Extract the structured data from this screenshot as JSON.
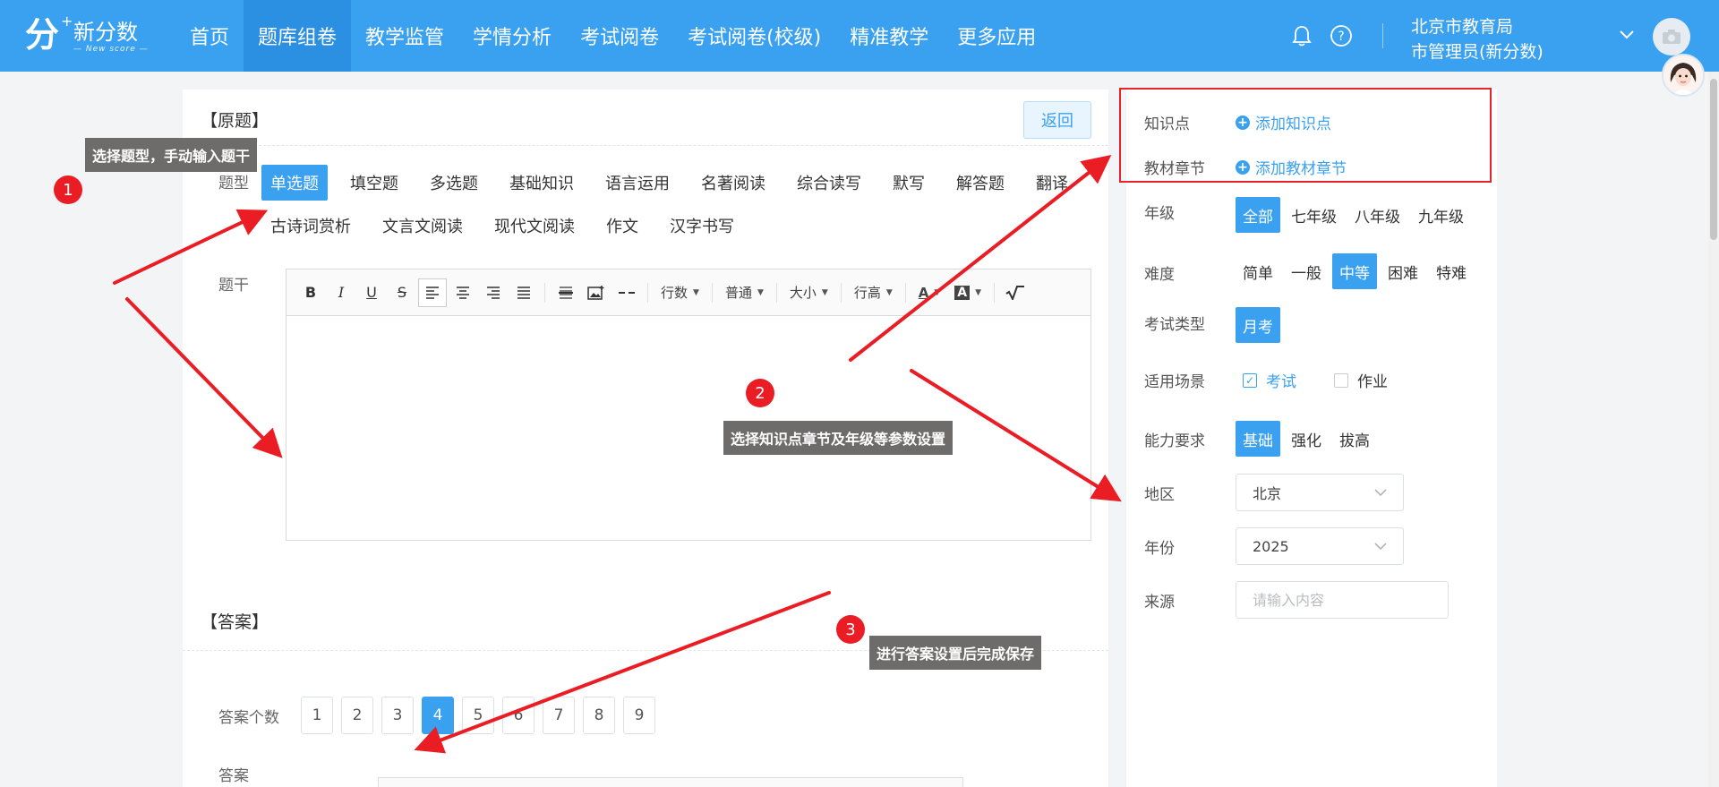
{
  "logo": {
    "name": "新分数",
    "tagline": "— New score —"
  },
  "nav": {
    "items": [
      "首页",
      "题库组卷",
      "教学监管",
      "学情分析",
      "考试阅卷",
      "考试阅卷(校级)",
      "精准教学",
      "更多应用"
    ],
    "active": "题库组卷"
  },
  "user": {
    "org": "北京市教育局",
    "role": "市管理员(新分数)"
  },
  "icons": {
    "bell": "bell-icon",
    "help": "help-icon",
    "caret": "chevron-down-icon",
    "camera": "camera-icon"
  },
  "original": {
    "title": "【原题】",
    "back_label": "返回",
    "type_label": "题型",
    "types_row1": [
      "单选题",
      "填空题",
      "多选题",
      "基础知识",
      "语言运用",
      "名著阅读",
      "综合读写",
      "默写",
      "解答题",
      "翻译"
    ],
    "types_row2": [
      "古诗词赏析",
      "文言文阅读",
      "现代文阅读",
      "作文",
      "汉字书写"
    ],
    "active_type": "单选题",
    "stem_label": "题干",
    "toolbar": {
      "bold": "B",
      "italic": "I",
      "underline": "U",
      "strike": "S",
      "dropdowns": [
        "行数",
        "普通",
        "大小",
        "行高"
      ],
      "font_color": "A",
      "bg_color": "A"
    }
  },
  "answer": {
    "title": "【答案】",
    "count_label": "答案个数",
    "counts": [
      "1",
      "2",
      "3",
      "4",
      "5",
      "6",
      "7",
      "8",
      "9"
    ],
    "active_count": "4",
    "answer_label": "答案"
  },
  "settings": {
    "knowledge_label": "知识点",
    "add_knowledge": "添加知识点",
    "chapter_label": "教材章节",
    "add_chapter": "添加教材章节",
    "grade_label": "年级",
    "grades": [
      "全部",
      "七年级",
      "八年级",
      "九年级"
    ],
    "active_grade": "全部",
    "difficulty_label": "难度",
    "difficulties": [
      "简单",
      "一般",
      "中等",
      "困难",
      "特难"
    ],
    "active_difficulty": "中等",
    "exam_type_label": "考试类型",
    "exam_type": "月考",
    "scene_label": "适用场景",
    "scene_exam": "考试",
    "scene_exam_checked": true,
    "scene_homework": "作业",
    "scene_homework_checked": false,
    "ability_label": "能力要求",
    "abilities": [
      "基础",
      "强化",
      "拔高"
    ],
    "active_ability": "基础",
    "region_label": "地区",
    "region": "北京",
    "year_label": "年份",
    "year": "2025",
    "source_label": "来源",
    "source_placeholder": "请输入内容"
  },
  "annotations": {
    "step1": "1",
    "tip1": "选择题型，手动输入题干",
    "step2": "2",
    "tip2": "选择知识点章节及年级等参数设置",
    "step3": "3",
    "tip3": "进行答案设置后完成保存",
    "accent": "#ea1c24"
  },
  "colors": {
    "primary": "#3aa0f0",
    "nav_active": "#2b8fe2",
    "tip_bg": "#6e6b6b"
  }
}
